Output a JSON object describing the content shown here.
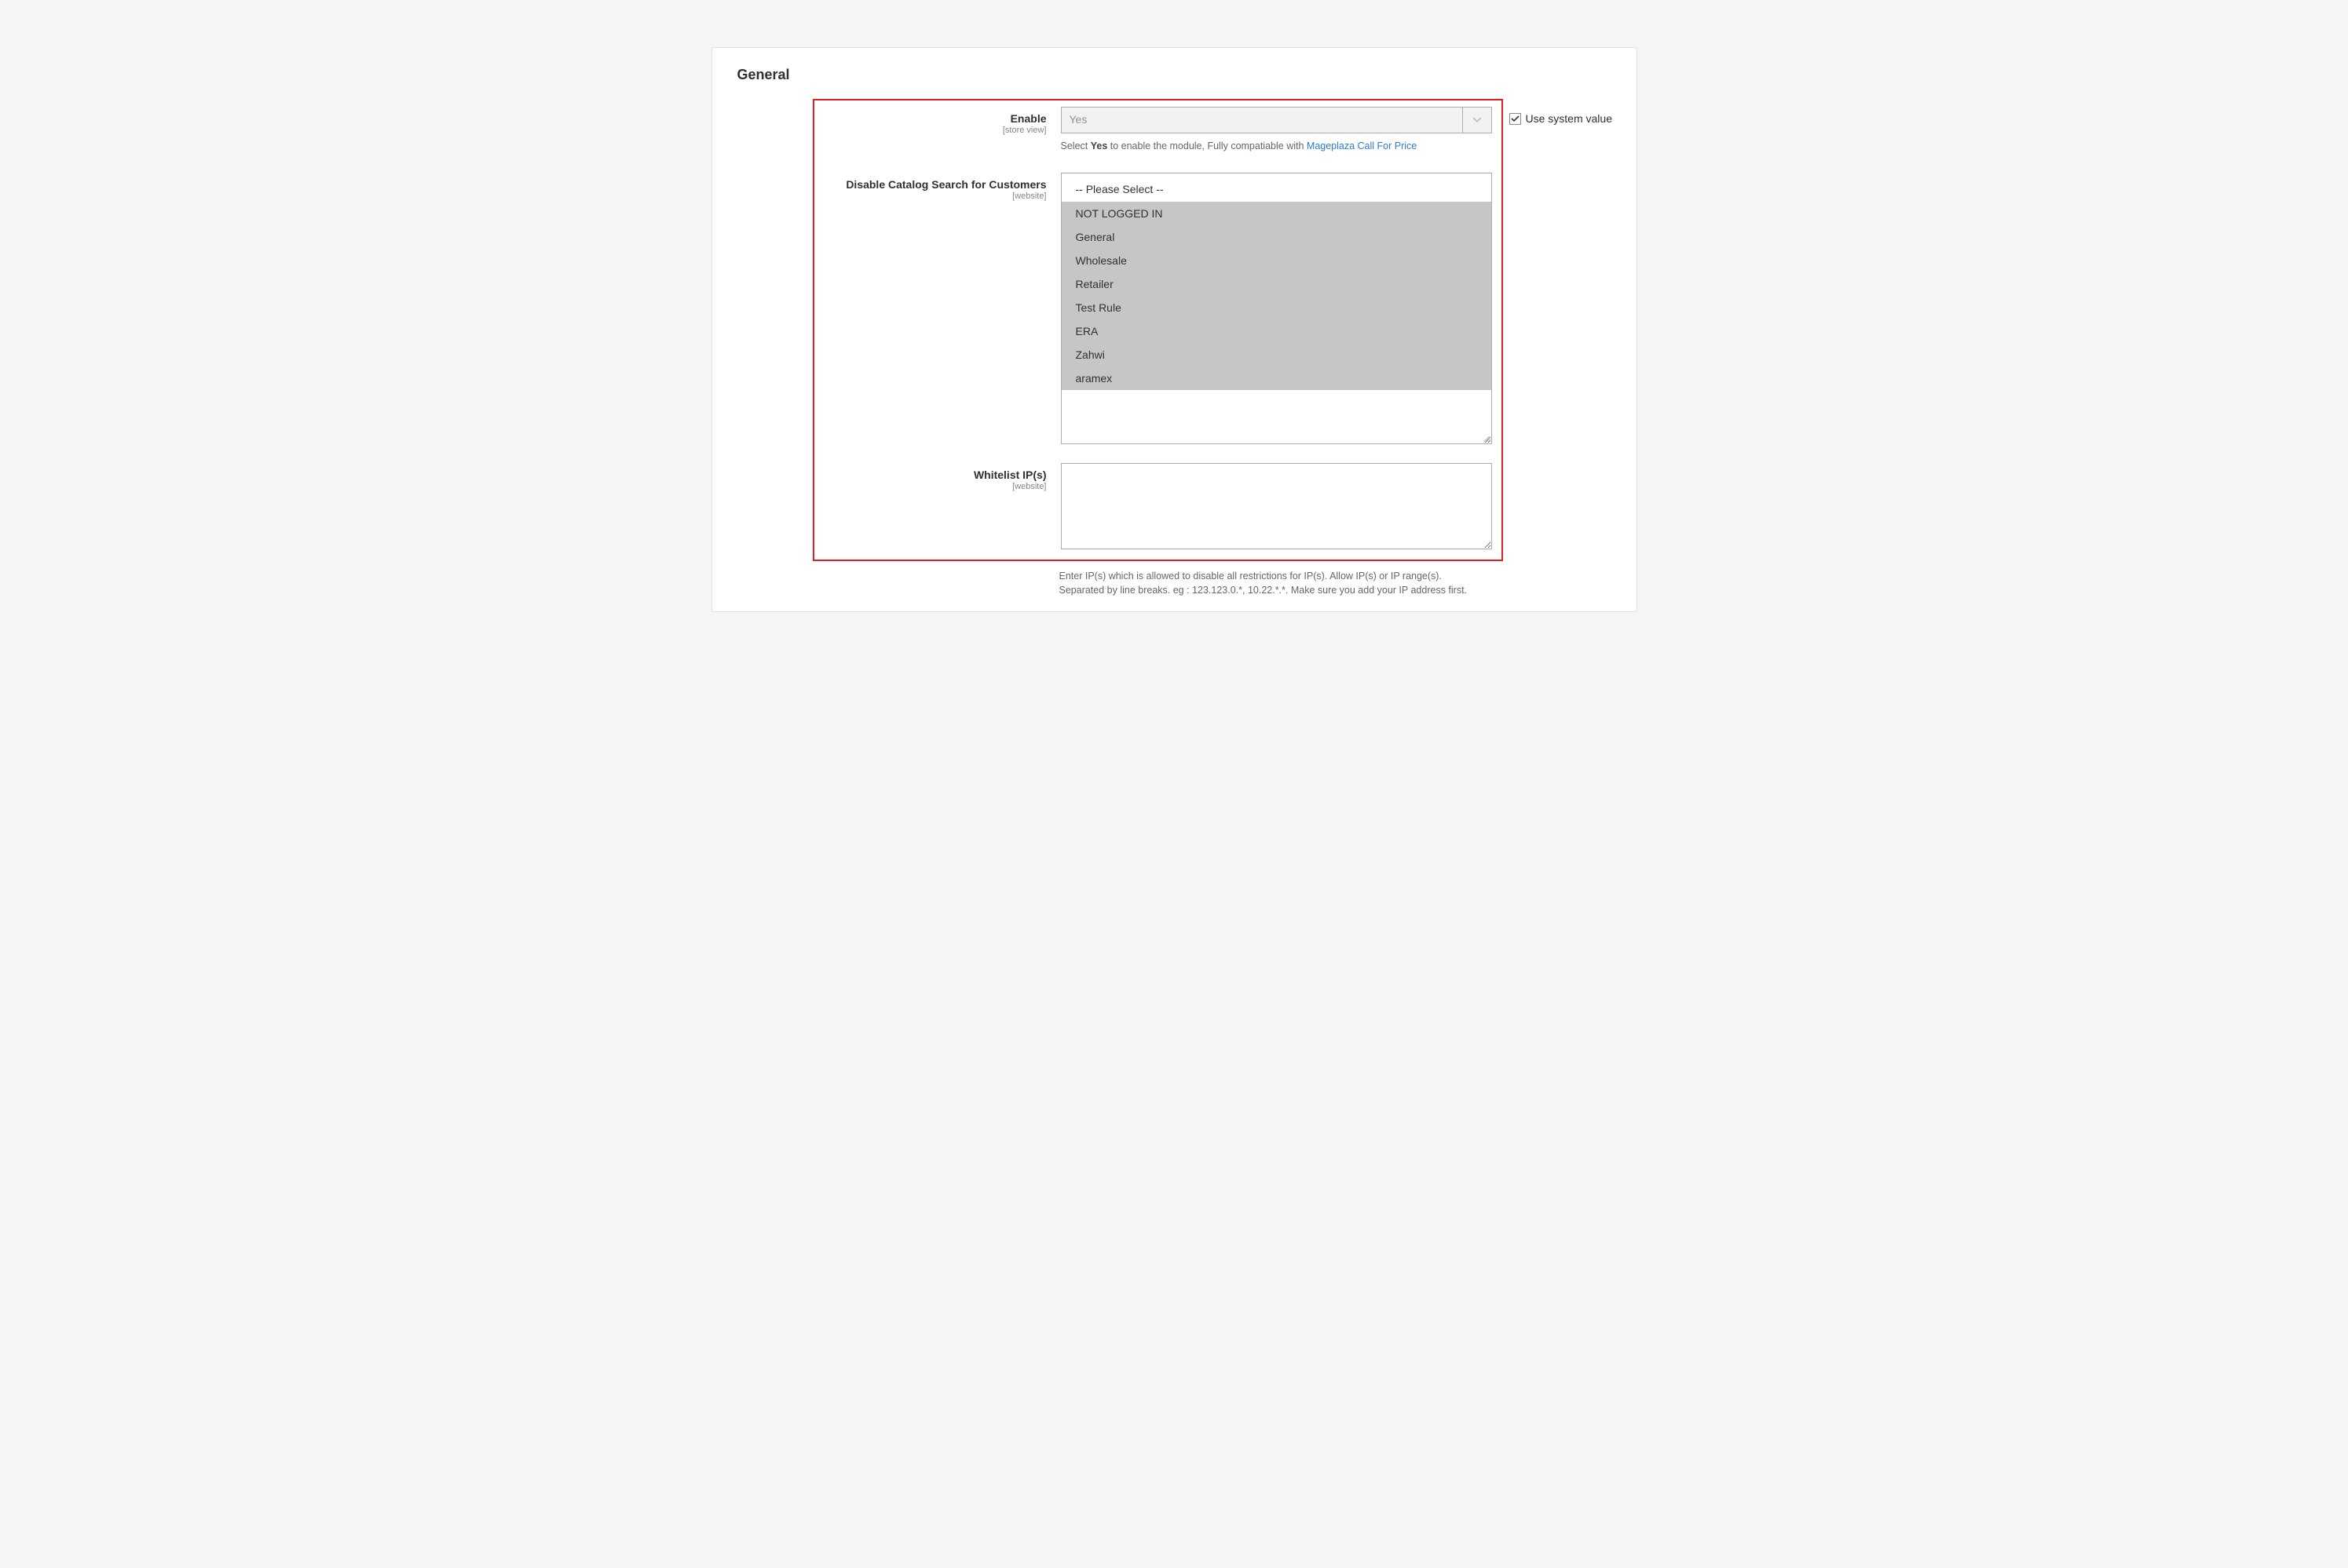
{
  "panel": {
    "title": "General"
  },
  "fields": {
    "enable": {
      "label": "Enable",
      "scope": "[store view]",
      "value": "Yes",
      "note_pre": "Select ",
      "note_bold": "Yes",
      "note_mid": " to enable the module, Fully compatiable with ",
      "note_link": "Mageplaza Call For Price",
      "use_system_label": "Use system value"
    },
    "disable_search": {
      "label": "Disable Catalog Search for Customers",
      "scope": "[website]",
      "options": {
        "placeholder": "-- Please Select --",
        "o1": "NOT LOGGED IN",
        "o2": "General",
        "o3": "Wholesale",
        "o4": "Retailer",
        "o5": "Test Rule",
        "o6": "ERA",
        "o7": "Zahwi",
        "o8": "aramex"
      }
    },
    "whitelist": {
      "label": "Whitelist IP(s)",
      "scope": "[website]",
      "value": "",
      "note": "Enter IP(s) which is allowed to disable all restrictions for IP(s). Allow IP(s) or IP range(s). Separated by line breaks. eg : 123.123.0.*, 10.22.*.*. Make sure you add your IP address first."
    }
  }
}
